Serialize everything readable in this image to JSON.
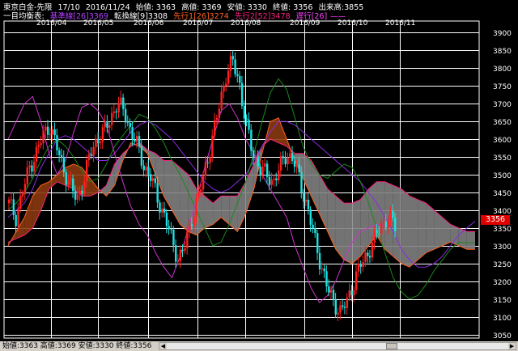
{
  "header": {
    "title": "東京白金-先限",
    "session": "17/10",
    "date": "2016/11/24",
    "open_text": "始値: 3363",
    "high_text": "高値: 3369",
    "low_text": "安値: 3330",
    "close_text": "終値: 3356",
    "volume_text": "出来高:3855"
  },
  "indicator_legend": {
    "label": "一目均衡表:",
    "kijun": "基準線[26]3369",
    "tenkan": "転換線[9]3308",
    "senkou1": "先行1[26]3274",
    "senkou2": "先行2[52]3478",
    "chikou": "遅行[26]"
  },
  "status_bar": {
    "text": "始値:3363  高値:3369  安値:3330  終値:3356"
  },
  "price_badge": "3356",
  "colors": {
    "background": "#000000",
    "grid": "#ffffff",
    "candle_up": "#ff2020",
    "candle_down": "#20e0e0",
    "kijun": "#8a2be2",
    "tenkan": "#ffffff",
    "senkou1": "#ff6020",
    "senkou2": "#ff2080",
    "chikou": "#cc33cc",
    "kumo_bull": "#8b3a10",
    "kumo_bear": "#808080"
  },
  "chart_data": {
    "type": "candlestick",
    "title": "東京白金-先限",
    "ylim": [
      3040,
      3910
    ],
    "y_ticks": [
      3050,
      3100,
      3150,
      3200,
      3250,
      3300,
      3350,
      3400,
      3450,
      3500,
      3550,
      3600,
      3650,
      3700,
      3750,
      3800,
      3850,
      3900
    ],
    "x_ticks": [
      "2016/04",
      "2016/05",
      "2016/06",
      "2016/07",
      "2016/08",
      "2016/09",
      "2016/10",
      "2016/11"
    ],
    "last_close": 3356,
    "last_bar": {
      "open": 3363,
      "high": 3369,
      "low": 3330,
      "close": 3356
    },
    "volume": 3855,
    "grid": true,
    "series": [
      {
        "name": "基準線",
        "value": 3369,
        "period": 26
      },
      {
        "name": "転換線",
        "value": 3308,
        "period": 9
      },
      {
        "name": "先行1",
        "value": 3274,
        "period": 26
      },
      {
        "name": "先行2",
        "value": 3478,
        "period": 52
      },
      {
        "name": "遅行",
        "period": 26
      }
    ],
    "close_path": [
      3420,
      3380,
      3450,
      3520,
      3560,
      3610,
      3640,
      3580,
      3520,
      3470,
      3430,
      3480,
      3560,
      3600,
      3620,
      3660,
      3700,
      3680,
      3620,
      3580,
      3520,
      3490,
      3430,
      3380,
      3320,
      3260,
      3300,
      3380,
      3440,
      3520,
      3600,
      3690,
      3780,
      3820,
      3760,
      3640,
      3560,
      3520,
      3500,
      3480,
      3520,
      3560,
      3540,
      3480,
      3410,
      3330,
      3250,
      3180,
      3140,
      3110,
      3150,
      3200,
      3250,
      3280,
      3320,
      3360,
      3380,
      3356
    ],
    "senkou1_path": [
      3300,
      3340,
      3380,
      3440,
      3470,
      3480,
      3500,
      3520,
      3530,
      3520,
      3490,
      3460,
      3440,
      3470,
      3540,
      3590,
      3580,
      3560,
      3500,
      3440,
      3400,
      3360,
      3340,
      3330,
      3350,
      3360,
      3380,
      3360,
      3340,
      3390,
      3460,
      3560,
      3650,
      3660,
      3600,
      3540,
      3490,
      3440,
      3390,
      3340,
      3290,
      3260,
      3250,
      3270,
      3300,
      3330,
      3290,
      3270,
      3250,
      3240,
      3260,
      3280,
      3290,
      3300,
      3310,
      3300,
      3290,
      3290
    ],
    "senkou2_path": [
      3310,
      3320,
      3330,
      3350,
      3400,
      3460,
      3480,
      3470,
      3460,
      3440,
      3440,
      3450,
      3470,
      3530,
      3560,
      3580,
      3590,
      3570,
      3560,
      3540,
      3540,
      3520,
      3500,
      3460,
      3440,
      3420,
      3440,
      3440,
      3440,
      3480,
      3530,
      3580,
      3600,
      3590,
      3580,
      3560,
      3560,
      3540,
      3500,
      3460,
      3440,
      3420,
      3420,
      3430,
      3460,
      3480,
      3480,
      3470,
      3460,
      3440,
      3430,
      3420,
      3400,
      3380,
      3360,
      3350,
      3340,
      3340
    ],
    "kijun_path": [
      3380,
      3400,
      3420,
      3460,
      3520,
      3560,
      3600,
      3610,
      3600,
      3580,
      3560,
      3540,
      3540,
      3560,
      3590,
      3620,
      3640,
      3650,
      3640,
      3620,
      3600,
      3570,
      3540,
      3510,
      3480,
      3460,
      3450,
      3460,
      3480,
      3500,
      3540,
      3580,
      3620,
      3650,
      3650,
      3640,
      3620,
      3600,
      3580,
      3560,
      3540,
      3520,
      3500,
      3480,
      3450,
      3420,
      3380,
      3340,
      3290,
      3260,
      3240,
      3240,
      3250,
      3270,
      3300,
      3330,
      3350,
      3369
    ],
    "tenkan_path": [
      3400,
      3420,
      3450,
      3490,
      3540,
      3580,
      3600,
      3580,
      3550,
      3510,
      3480,
      3490,
      3530,
      3580,
      3610,
      3640,
      3670,
      3660,
      3630,
      3590,
      3540,
      3500,
      3450,
      3400,
      3350,
      3300,
      3310,
      3360,
      3420,
      3480,
      3560,
      3650,
      3730,
      3770,
      3740,
      3660,
      3580,
      3530,
      3500,
      3490,
      3510,
      3530,
      3520,
      3480,
      3420,
      3350,
      3280,
      3210,
      3170,
      3150,
      3160,
      3190,
      3230,
      3260,
      3290,
      3310,
      3308,
      3308
    ],
    "chikou_path": [
      3600,
      3650,
      3700,
      3720,
      3650,
      3560,
      3500,
      3540,
      3620,
      3690,
      3700,
      3680,
      3640,
      3560,
      3480,
      3410,
      3360,
      3330,
      3280,
      3240,
      3210,
      3270,
      3350,
      3430,
      3520,
      3600,
      3680,
      3700,
      3660,
      3600,
      3560,
      3500,
      3460,
      3420,
      3380,
      3300,
      3240,
      3180,
      3140,
      3160,
      3200,
      3260,
      3310,
      3340,
      3350,
      3360,
      3356
    ]
  }
}
